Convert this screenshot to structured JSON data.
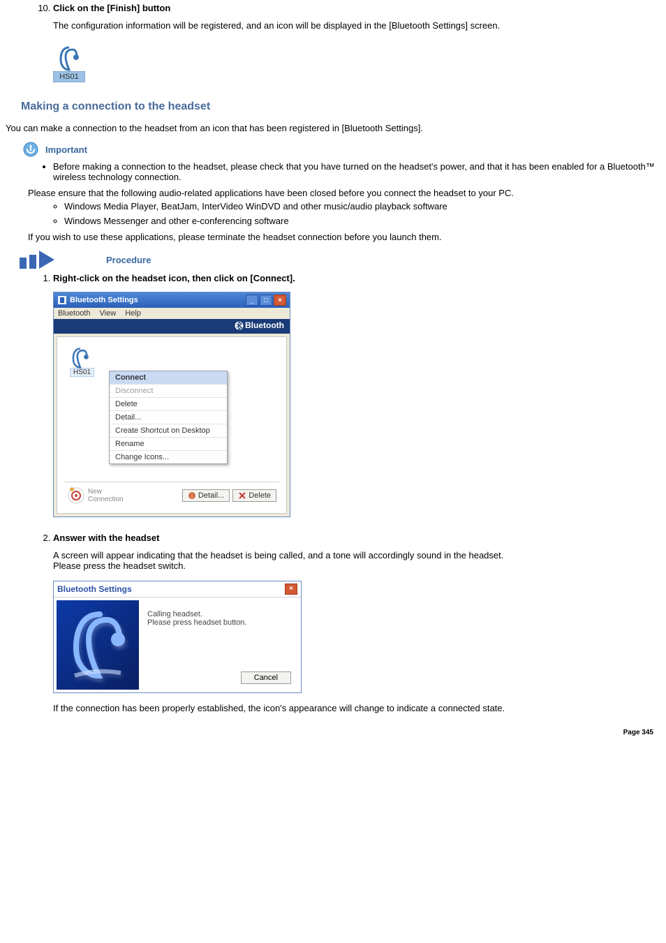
{
  "step10": {
    "title": "Click on the [Finish] button",
    "body": "The configuration information will be registered, and an icon will be displayed in the [Bluetooth Settings] screen.",
    "icon_label": "HS01"
  },
  "section_heading": "Making a connection to the headset",
  "section_intro": "You can make a connection to the headset from an icon that has been registered in [Bluetooth Settings].",
  "important_label": "Important",
  "important_bullet": "Before making a connection to the headset, please check that you have turned on the headset's power, and that it has been enabled for a Bluetooth™ wireless technology connection.",
  "ensure_text": "Please ensure that the following audio-related applications have been closed before you connect the headset to your PC.",
  "app_examples": [
    "Windows Media Player, BeatJam, InterVideo WinDVD and other music/audio playback software",
    "Windows Messenger and other e-conferencing software"
  ],
  "if_wish": "If you wish to use these applications, please terminate the headset connection before you launch them.",
  "procedure_label": "Procedure",
  "proc_step1": {
    "title": "Right-click on the headset icon, then click on [Connect].",
    "window": {
      "title": "Bluetooth Settings",
      "menus": [
        "Bluetooth",
        "View",
        "Help"
      ],
      "brand": "Bluetooth",
      "icon_label": "HS01",
      "context_menu": [
        "Connect",
        "Disconnect",
        "Delete",
        "Detail...",
        "Create Shortcut on Desktop",
        "Rename",
        "Change Icons..."
      ],
      "new_connection": "New\nConnection",
      "detail_btn": "Detail...",
      "delete_btn": "Delete"
    }
  },
  "proc_step2": {
    "title": "Answer with the headset",
    "body1": "A screen will appear indicating that the headset is being called, and a tone will accordingly sound in the headset.",
    "body2": "Please press the headset switch.",
    "dialog": {
      "title": "Bluetooth Settings",
      "line1": "Calling headset.",
      "line2": "Please press headset button.",
      "cancel": "Cancel"
    },
    "after": "If the connection has been properly established, the icon's appearance will change to indicate a connected state."
  },
  "page_num": "Page 345"
}
